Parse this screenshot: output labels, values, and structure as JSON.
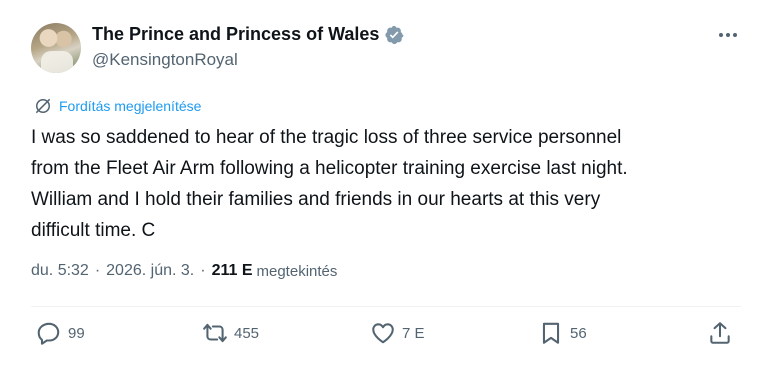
{
  "author": {
    "display_name": "The Prince and Princess of Wales",
    "handle": "@KensingtonRoyal",
    "verified": true
  },
  "translate_label": "Fordítás megjelenítése",
  "tweet": {
    "lines": [
      "I was so saddened to hear of the tragic loss of three service personnel",
      "from the Fleet Air Arm following a helicopter training exercise last night.",
      "William and I hold their families and friends in our hearts at this very",
      "difficult time. C"
    ]
  },
  "meta": {
    "time": "du. 5:32",
    "date": "2026. jún. 3.",
    "separator": "·",
    "views_count": "211 E",
    "views_label": "megtekintés"
  },
  "actions": {
    "reply_count": "99",
    "retweet_count": "455",
    "like_count": "7 E",
    "bookmark_count": "56"
  },
  "colors": {
    "text": "#0f1419",
    "secondary": "#536471",
    "accent": "#1d9bf0",
    "verified_badge": "#829aab"
  }
}
